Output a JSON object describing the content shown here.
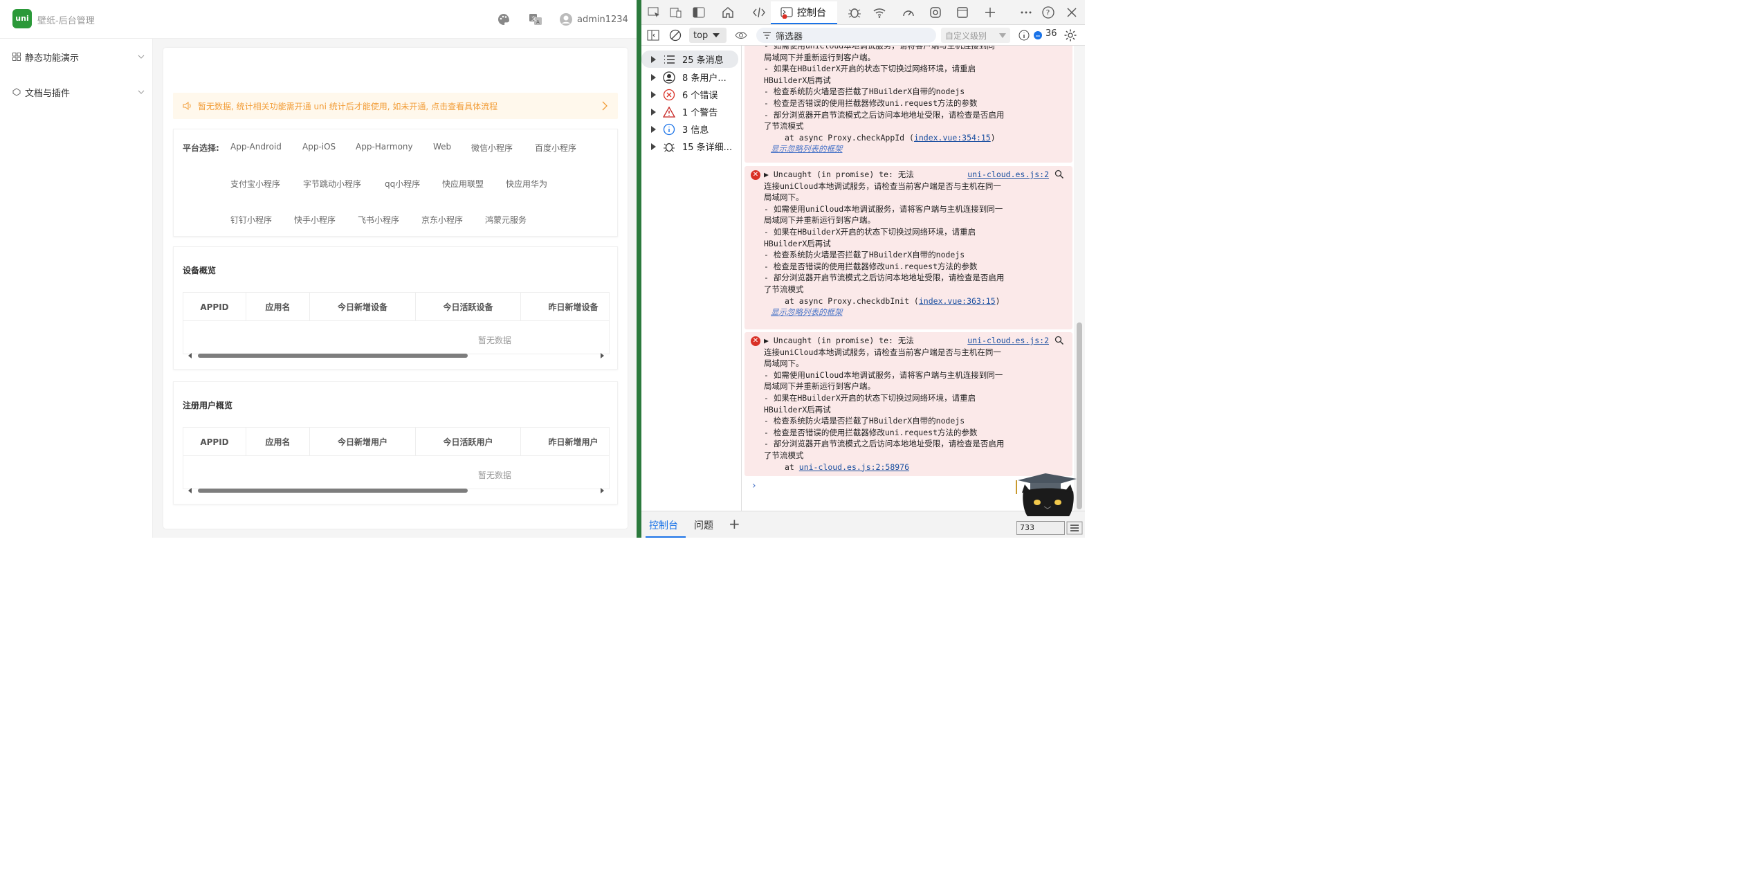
{
  "app": {
    "logo_text": "uni",
    "title": "壁纸-后台管理",
    "user": "admin1234"
  },
  "sidebar": {
    "items": [
      {
        "label": "静态功能演示"
      },
      {
        "label": "文档与插件"
      }
    ]
  },
  "main": {
    "tip": "暂无数据, 统计相关功能需开通 uni 统计后才能使用, 如未开通, 点击查看具体流程",
    "platform_label": "平台选择:",
    "platforms": [
      "App-Android",
      "App-iOS",
      "App-Harmony",
      "Web",
      "微信小程序",
      "百度小程序",
      "支付宝小程序",
      "字节跳动小程序",
      "qq小程序",
      "快应用联盟",
      "快应用华为",
      "钉钉小程序",
      "快手小程序",
      "飞书小程序",
      "京东小程序",
      "鸿蒙元服务"
    ],
    "device_section": {
      "title": "设备概览",
      "columns": [
        "APPID",
        "应用名",
        "今日新增设备",
        "今日活跃设备",
        "昨日新增设备"
      ],
      "empty": "暂无数据"
    },
    "user_section": {
      "title": "注册用户概览",
      "columns": [
        "APPID",
        "应用名",
        "今日新增用户",
        "今日活跃用户",
        "昨日新增用户"
      ],
      "empty": "暂无数据"
    }
  },
  "devtools": {
    "active_tab": "控制台",
    "context": "top",
    "filter_placeholder": "筛选器",
    "level": "自定义级别",
    "message_count": "36",
    "sidebar": [
      {
        "label": "25 条消息"
      },
      {
        "label": "8 条用户..."
      },
      {
        "label": "6 个错误"
      },
      {
        "label": "1 个警告"
      },
      {
        "label": "3 信息"
      },
      {
        "label": "15 条详细..."
      }
    ],
    "msg1_lines": [
      "- 如需使用uniCloud本地调试服务，请将客户端与主机连接到同",
      "局域网下并重新运行到客户端。",
      "- 如果在HBuilderX开启的状态下切换过网络环境，请重启",
      "HBuilderX后再试",
      "- 检查系统防火墙是否拦截了HBuilderX自带的nodejs",
      "- 检查是否错误的使用拦截器修改uni.request方法的参数",
      "- 部分浏览器开启节流模式之后访问本地地址受限，请检查是否启用",
      "了节流模式"
    ],
    "msg1_at": "at async Proxy.checkAppId (",
    "msg1_link": "index.vue:354:15",
    "msg_close": ")",
    "hidden_frames": "显示忽略列表的框架",
    "error_head": "Uncaught (in promise) te: 无法",
    "error_source": "uni-cloud.es.js:2",
    "error_lines": [
      "连接uniCloud本地调试服务，请检查当前客户端是否与主机在同一",
      "局域网下。",
      "- 如需使用uniCloud本地调试服务，请将客户端与主机连接到同一",
      "局域网下并重新运行到客户端。",
      "- 如果在HBuilderX开启的状态下切换过网络环境，请重启",
      "HBuilderX后再试",
      "- 检查系统防火墙是否拦截了HBuilderX自带的nodejs",
      "- 检查是否错误的使用拦截器修改uni.request方法的参数",
      "- 部分浏览器开启节流模式之后访问本地地址受限，请检查是否启用",
      "了节流模式"
    ],
    "msg2_at": "at async Proxy.checkdbInit (",
    "msg2_link": "index.vue:363:15",
    "msg3_at": "at ",
    "msg3_link": "uni-cloud.es.js:2:58976",
    "prompt": "›",
    "drawer_tabs": [
      "控制台",
      "问题"
    ],
    "status_number": "733"
  }
}
